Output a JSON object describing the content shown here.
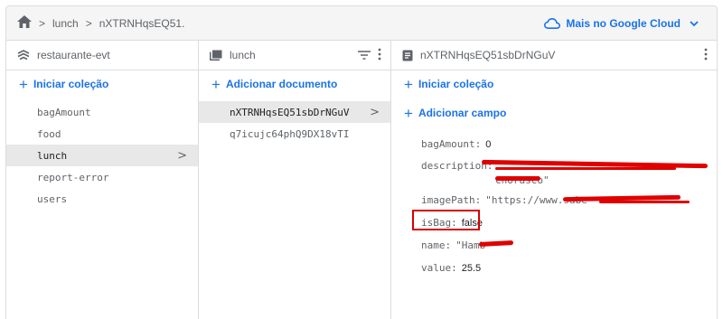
{
  "breadcrumb": {
    "items": [
      "lunch",
      "nXTRNHqsEQ51."
    ]
  },
  "header": {
    "cloud_label": "Mais no Google Cloud"
  },
  "columns": {
    "root": {
      "title": "restaurante-evt",
      "action_label": "Iniciar coleção",
      "items": [
        "bagAmount",
        "food",
        "lunch",
        "report-error",
        "users"
      ],
      "selected": "lunch"
    },
    "collection": {
      "title": "lunch",
      "action_label": "Adicionar documento",
      "items": [
        "nXTRNHqsEQ51sbDrNGuV",
        "q7icujc64phQ9DX18vTI"
      ],
      "selected": "nXTRNHqsEQ51sbDrNGuV"
    },
    "document": {
      "title": "nXTRNHqsEQ51sbDrNGuV",
      "action_collection": "Iniciar coleção",
      "action_field": "Adicionar campo",
      "fields": [
        {
          "key": "bagAmount:",
          "value": "0"
        },
        {
          "key": "description:",
          "value": "\"",
          "value_tail": "chorasco\""
        },
        {
          "key": "imagePath:",
          "value": "\"https://www.sabe"
        },
        {
          "key": "isBag:",
          "value": "false"
        },
        {
          "key": "name:",
          "value": "\"Hamb"
        },
        {
          "key": "value:",
          "value": "25.5"
        }
      ]
    }
  },
  "colors": {
    "accent": "#1a73e8",
    "highlight_box": "#d50000",
    "redaction": "#e00000"
  }
}
